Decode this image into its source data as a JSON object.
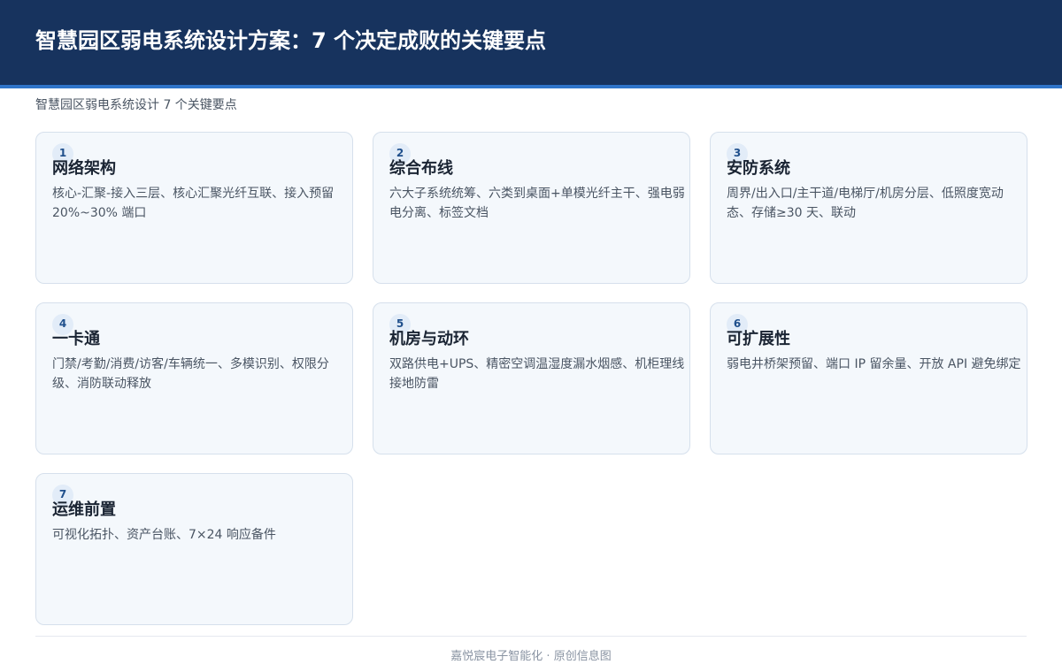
{
  "header": {
    "title": "智慧园区弱电系统设计方案：7 个决定成败的关键要点"
  },
  "subtitle": "智慧园区弱电系统设计 7 个关键要点",
  "cards": [
    {
      "num": "1",
      "title": "网络架构",
      "desc": "核心-汇聚-接入三层、核心汇聚光纤互联、接入预留 20%~30% 端口"
    },
    {
      "num": "2",
      "title": "综合布线",
      "desc": "六大子系统统筹、六类到桌面+单模光纤主干、强电弱电分离、标签文档"
    },
    {
      "num": "3",
      "title": "安防系统",
      "desc": "周界/出入口/主干道/电梯厅/机房分层、低照度宽动态、存储≥30 天、联动"
    },
    {
      "num": "4",
      "title": "一卡通",
      "desc": "门禁/考勤/消费/访客/车辆统一、多模识别、权限分级、消防联动释放"
    },
    {
      "num": "5",
      "title": "机房与动环",
      "desc": "双路供电+UPS、精密空调温湿度漏水烟感、机柜理线接地防雷"
    },
    {
      "num": "6",
      "title": "可扩展性",
      "desc": "弱电井桥架预留、端口 IP 留余量、开放 API 避免绑定"
    },
    {
      "num": "7",
      "title": "运维前置",
      "desc": "可视化拓扑、资产台账、7×24 响应备件"
    }
  ],
  "footer": "嘉悦宸电子智能化 · 原创信息图"
}
